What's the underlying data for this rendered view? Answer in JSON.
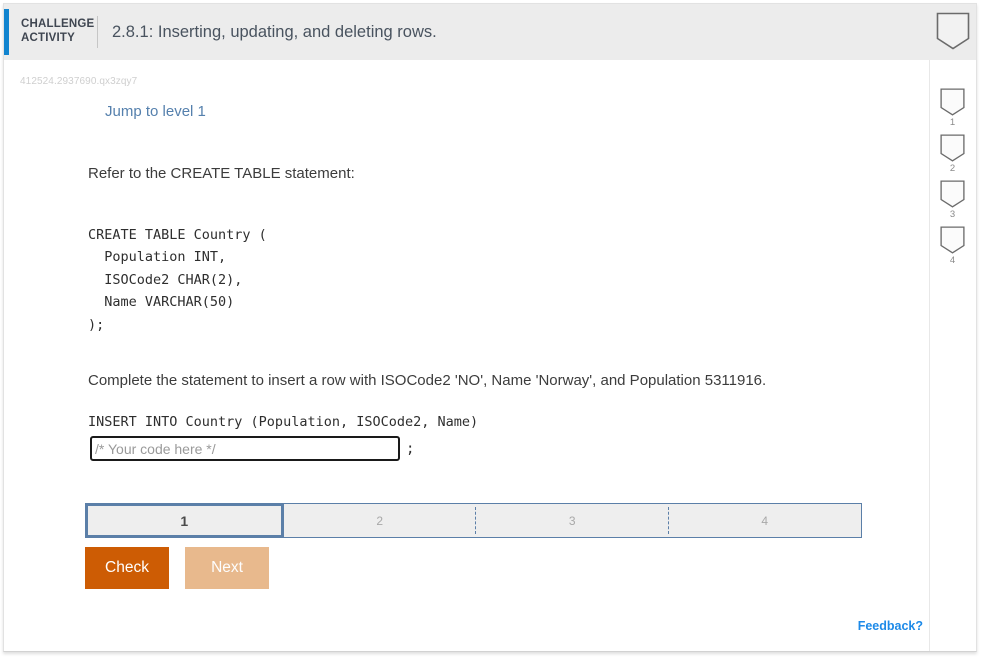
{
  "header": {
    "label_line1": "CHALLENGE",
    "label_line2": "ACTIVITY",
    "title": "2.8.1: Inserting, updating, and deleting rows.",
    "accent_color": "#1184cf",
    "background": "#ececec"
  },
  "rail": {
    "badges": [
      {
        "number": "1"
      },
      {
        "number": "2"
      },
      {
        "number": "3"
      },
      {
        "number": "4"
      }
    ]
  },
  "body": {
    "activity_id": "412524.2937690.qx3zqy7",
    "jump_link": "Jump to level 1",
    "refer_text": "Refer to the CREATE TABLE statement:",
    "code": "CREATE TABLE Country (\n  Population INT,\n  ISOCode2 CHAR(2),\n  Name VARCHAR(50)\n);",
    "complete_text": "Complete the statement to insert a row with ISOCode2 'NO', Name 'Norway', and Population 5311916.",
    "insert_line": "INSERT INTO Country (Population, ISOCode2, Name)",
    "answer_value": "",
    "answer_placeholder": "/* Your code here */",
    "statement_terminator": ";"
  },
  "progress": {
    "segments": [
      {
        "label": "1",
        "active": true
      },
      {
        "label": "2",
        "active": false
      },
      {
        "label": "3",
        "active": false
      },
      {
        "label": "4",
        "active": false
      }
    ],
    "border_color": "#5b7fa8"
  },
  "buttons": {
    "check_label": "Check",
    "check_color": "#cd5c04",
    "next_label": "Next",
    "next_color": "#e8b98d"
  },
  "footer": {
    "feedback_label": "Feedback?",
    "feedback_color": "#1d8ae8"
  }
}
